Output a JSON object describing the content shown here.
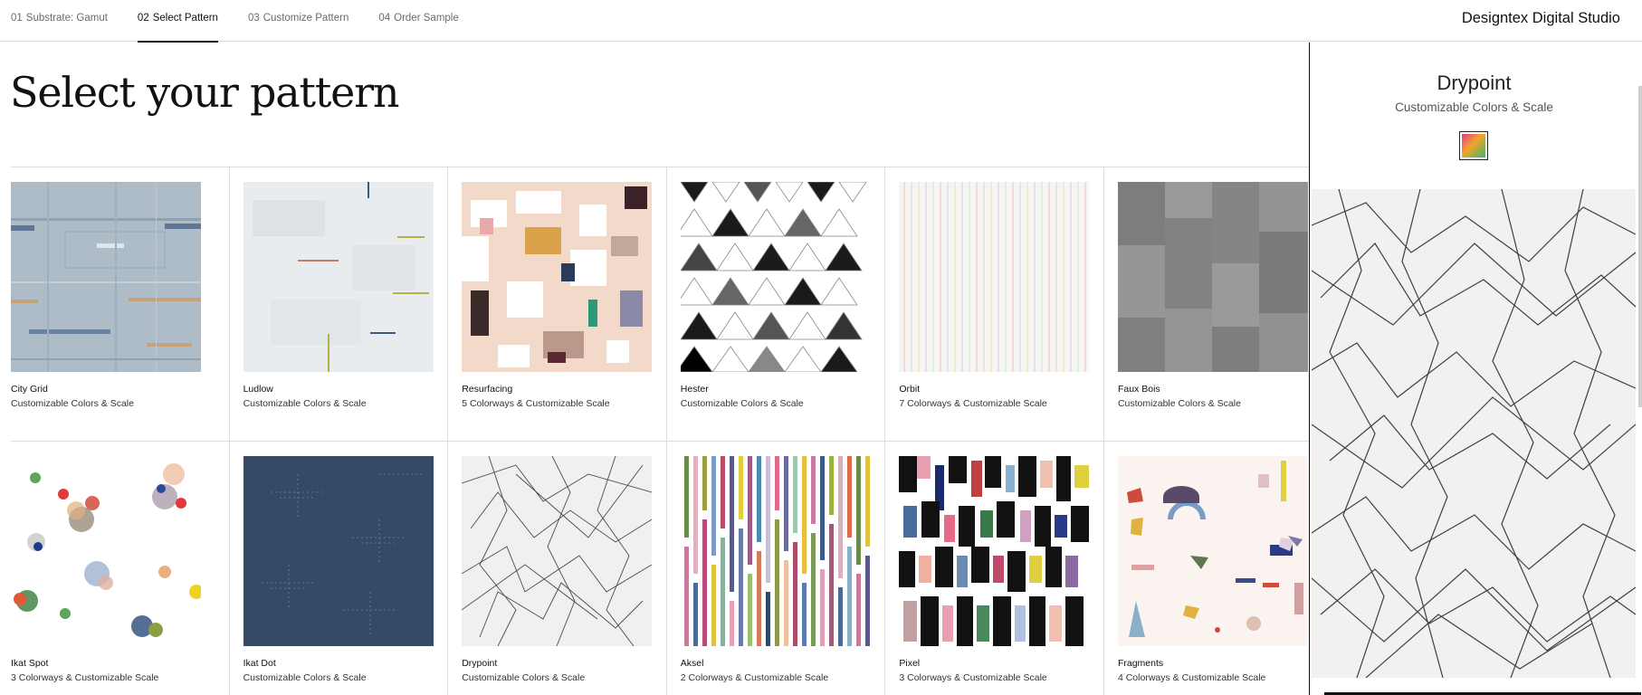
{
  "nav": {
    "steps": [
      {
        "num": "01",
        "label": "Substrate: Gamut"
      },
      {
        "num": "02",
        "label": "Select Pattern"
      },
      {
        "num": "03",
        "label": "Customize Pattern"
      },
      {
        "num": "04",
        "label": "Order Sample"
      }
    ],
    "active_step": 1,
    "brand": "Designtex Digital Studio"
  },
  "main": {
    "title": "Select your pattern",
    "patterns": [
      {
        "name": "City Grid",
        "desc": "Customizable Colors & Scale",
        "icon": "city-grid-swatch"
      },
      {
        "name": "Ludlow",
        "desc": "Customizable Colors & Scale",
        "icon": "ludlow-swatch"
      },
      {
        "name": "Resurfacing",
        "desc": "5 Colorways & Customizable Scale",
        "icon": "resurfacing-swatch"
      },
      {
        "name": "Hester",
        "desc": "Customizable Colors & Scale",
        "icon": "hester-swatch"
      },
      {
        "name": "Orbit",
        "desc": "7 Colorways & Customizable Scale",
        "icon": "orbit-swatch"
      },
      {
        "name": "Faux Bois",
        "desc": "Customizable Colors & Scale",
        "icon": "faux-bois-swatch"
      },
      {
        "name": "Ikat Spot",
        "desc": "3 Colorways & Customizable Scale",
        "icon": "ikat-spot-swatch"
      },
      {
        "name": "Ikat Dot",
        "desc": "Customizable Colors & Scale",
        "icon": "ikat-dot-swatch"
      },
      {
        "name": "Drypoint",
        "desc": "Customizable Colors & Scale",
        "icon": "drypoint-swatch"
      },
      {
        "name": "Aksel",
        "desc": "2 Colorways & Customizable Scale",
        "icon": "aksel-swatch"
      },
      {
        "name": "Pixel",
        "desc": "3 Colorways & Customizable Scale",
        "icon": "pixel-swatch"
      },
      {
        "name": "Fragments",
        "desc": "4 Colorways & Customizable Scale",
        "icon": "fragments-swatch"
      }
    ]
  },
  "panel": {
    "title": "Drypoint",
    "subtitle": "Customizable Colors & Scale",
    "color_chip_icon": "rainbow-gradient-chip",
    "preview_icon": "drypoint-preview"
  },
  "colors": {
    "text": "#111111",
    "muted": "#6b6b6b",
    "divider": "#dcdcdc",
    "ikat_dot_navy": "#344a66",
    "city_grid_blue": "#aebcc8"
  }
}
